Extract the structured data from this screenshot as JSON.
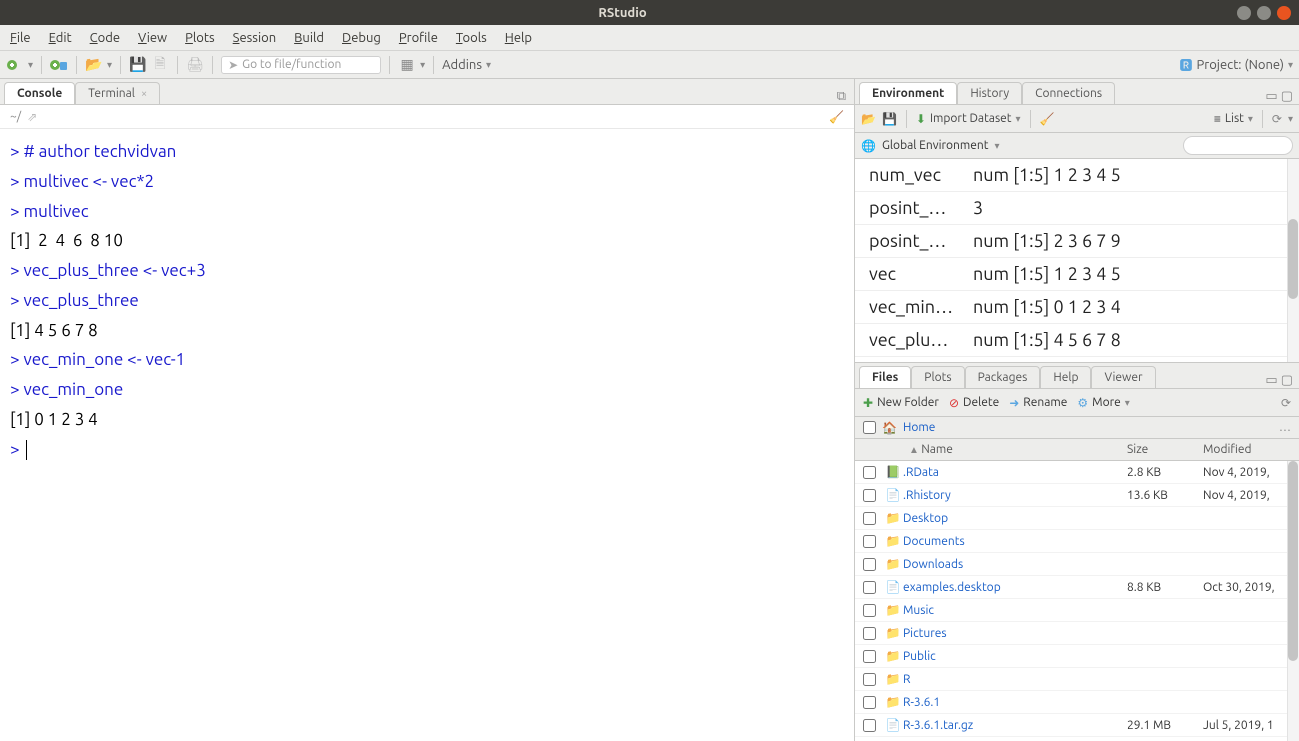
{
  "titlebar": {
    "title": "RStudio"
  },
  "menubar": [
    "File",
    "Edit",
    "Code",
    "View",
    "Plots",
    "Session",
    "Build",
    "Debug",
    "Profile",
    "Tools",
    "Help"
  ],
  "toolbar": {
    "gotofile_placeholder": "Go to file/function",
    "addins_label": "Addins",
    "project_label": "Project: (None)"
  },
  "left": {
    "tabs": {
      "console": "Console",
      "terminal": "Terminal"
    },
    "path": "~/",
    "console_lines": [
      {
        "prompt": ">",
        "text": " # author techvidvan",
        "cls": "cblue"
      },
      {
        "prompt": ">",
        "text": " multivec <- vec*2",
        "cls": "cblue"
      },
      {
        "prompt": ">",
        "text": " multivec",
        "cls": "cblue"
      },
      {
        "prompt": "",
        "text": "[1]  2  4  6  8 10",
        "cls": "cblack"
      },
      {
        "prompt": ">",
        "text": " vec_plus_three <- vec+3",
        "cls": "cblue"
      },
      {
        "prompt": ">",
        "text": " vec_plus_three",
        "cls": "cblue"
      },
      {
        "prompt": "",
        "text": "[1] 4 5 6 7 8",
        "cls": "cblack"
      },
      {
        "prompt": ">",
        "text": " vec_min_one <- vec-1",
        "cls": "cblue"
      },
      {
        "prompt": ">",
        "text": " vec_min_one",
        "cls": "cblue"
      },
      {
        "prompt": "",
        "text": "[1] 0 1 2 3 4",
        "cls": "cblack"
      },
      {
        "prompt": ">",
        "text": " ",
        "cls": "cblue",
        "cursor": true
      }
    ]
  },
  "env": {
    "tabs": {
      "environment": "Environment",
      "history": "History",
      "connections": "Connections"
    },
    "import_label": "Import Dataset",
    "list_label": "List",
    "scope_label": "Global Environment",
    "vars": [
      {
        "name": "num_vec",
        "value": "num [1:5] 1 2 3 4 5"
      },
      {
        "name": "posint_…",
        "value": "3"
      },
      {
        "name": "posint_…",
        "value": "num [1:5] 2 3 6 7 9"
      },
      {
        "name": "vec",
        "value": "num [1:5] 1 2 3 4 5"
      },
      {
        "name": "vec_min…",
        "value": "num [1:5] 0 1 2 3 4"
      },
      {
        "name": "vec_plu…",
        "value": "num [1:5] 4 5 6 7 8"
      }
    ]
  },
  "files": {
    "tabs": {
      "files": "Files",
      "plots": "Plots",
      "packages": "Packages",
      "help": "Help",
      "viewer": "Viewer"
    },
    "new_folder": "New Folder",
    "delete": "Delete",
    "rename": "Rename",
    "more": "More",
    "breadcrumb_home": "Home",
    "headers": {
      "name": "Name",
      "size": "Size",
      "modified": "Modified"
    },
    "rows": [
      {
        "icon": "rdata",
        "name": ".RData",
        "size": "2.8 KB",
        "modified": "Nov 4, 2019,"
      },
      {
        "icon": "doc",
        "name": ".Rhistory",
        "size": "13.6 KB",
        "modified": "Nov 4, 2019,"
      },
      {
        "icon": "folder",
        "name": "Desktop",
        "size": "",
        "modified": ""
      },
      {
        "icon": "folder",
        "name": "Documents",
        "size": "",
        "modified": ""
      },
      {
        "icon": "folder",
        "name": "Downloads",
        "size": "",
        "modified": ""
      },
      {
        "icon": "doc",
        "name": "examples.desktop",
        "size": "8.8 KB",
        "modified": "Oct 30, 2019,"
      },
      {
        "icon": "folder",
        "name": "Music",
        "size": "",
        "modified": ""
      },
      {
        "icon": "folder",
        "name": "Pictures",
        "size": "",
        "modified": ""
      },
      {
        "icon": "folder-lock",
        "name": "Public",
        "size": "",
        "modified": ""
      },
      {
        "icon": "folder",
        "name": "R",
        "size": "",
        "modified": ""
      },
      {
        "icon": "folder",
        "name": "R-3.6.1",
        "size": "",
        "modified": ""
      },
      {
        "icon": "doc",
        "name": "R-3.6.1.tar.gz",
        "size": "29.1 MB",
        "modified": "Jul 5, 2019, 1"
      }
    ]
  }
}
